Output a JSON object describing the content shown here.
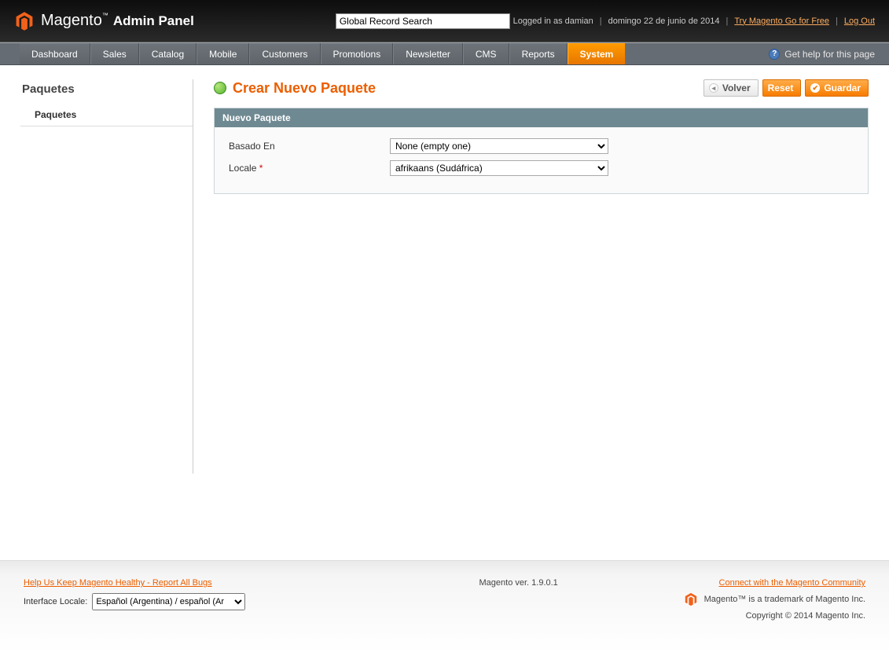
{
  "header": {
    "logo_main": "Magento",
    "logo_sub": "Admin Panel",
    "search_placeholder": "Global Record Search",
    "logged_in_text": "Logged in as damian",
    "date_text": "domingo 22 de junio de 2014",
    "try_link": "Try Magento Go for Free",
    "logout_link": "Log Out"
  },
  "nav": {
    "items": [
      {
        "label": "Dashboard"
      },
      {
        "label": "Sales"
      },
      {
        "label": "Catalog"
      },
      {
        "label": "Mobile"
      },
      {
        "label": "Customers"
      },
      {
        "label": "Promotions"
      },
      {
        "label": "Newsletter"
      },
      {
        "label": "CMS"
      },
      {
        "label": "Reports"
      },
      {
        "label": "System"
      }
    ],
    "active_index": 9,
    "help_text": "Get help for this page"
  },
  "sidebar": {
    "title": "Paquetes",
    "items": [
      {
        "label": "Paquetes"
      }
    ]
  },
  "page": {
    "title": "Crear Nuevo Paquete",
    "buttons": {
      "back": "Volver",
      "reset": "Reset",
      "save": "Guardar"
    }
  },
  "form": {
    "section_title": "Nuevo Paquete",
    "rows": {
      "basado_en": {
        "label": "Basado En",
        "value": "None (empty one)"
      },
      "locale": {
        "label": "Locale",
        "required_marker": "*",
        "value": "afrikaans (Sudáfrica)"
      }
    }
  },
  "footer": {
    "bugs_link": "Help Us Keep Magento Healthy - Report All Bugs",
    "locale_label": "Interface Locale:",
    "locale_value": "Español (Argentina) / español (Ar",
    "version": "Magento ver. 1.9.0.1",
    "community_link": "Connect with the Magento Community",
    "trademark": "Magento™ is a trademark of Magento Inc.",
    "copyright": "Copyright © 2014 Magento Inc."
  }
}
